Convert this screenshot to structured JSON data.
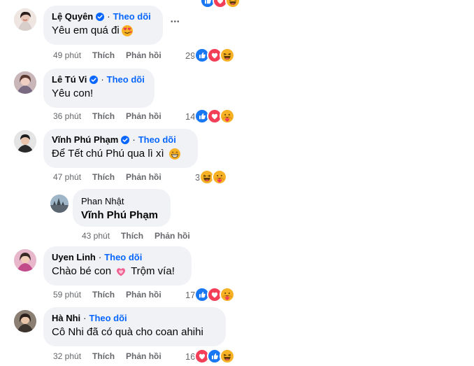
{
  "comments": [
    {
      "name": "Lệ Quyên",
      "follow": "Theo dõi",
      "text": "Yêu em quá đi",
      "emoji": "heart-eyes-emoji",
      "time": "49 phút",
      "like": "Thích",
      "reply": "Phản hồi",
      "reaction_count": "29",
      "reactions": [
        "like-reaction-icon",
        "love-reaction-icon",
        "haha-reaction-icon"
      ]
    },
    {
      "name": "Lê Tú Vi",
      "follow": "Theo dõi",
      "text": "Yêu con!",
      "time": "36 phút",
      "like": "Thích",
      "reply": "Phản hồi",
      "reaction_count": "14",
      "reactions": [
        "like-reaction-icon",
        "love-reaction-icon",
        "care-reaction-icon"
      ]
    },
    {
      "name": "Vĩnh Phú Phạm",
      "follow": "Theo dõi",
      "text": "Để Tết chú Phú qua lì xì",
      "emoji": "grin-emoji",
      "time": "47 phút",
      "like": "Thích",
      "reply": "Phản hồi",
      "reaction_count": "3",
      "reactions": [
        "haha-reaction-icon",
        "care-reaction-icon"
      ]
    },
    {
      "name": "Phan Nhật",
      "text": "Vĩnh Phú Phạm",
      "time": "43 phút",
      "like": "Thích",
      "reply": "Phản hồi"
    },
    {
      "name": "Uyen Linh",
      "follow": "Theo dõi",
      "text_before": "Chào bé con",
      "text_after": "Trộm vía!",
      "emoji": "pink-heart-emoji",
      "time": "59 phút",
      "like": "Thích",
      "reply": "Phản hồi",
      "reaction_count": "17",
      "reactions": [
        "like-reaction-icon",
        "love-reaction-icon",
        "care-reaction-icon"
      ]
    },
    {
      "name": "Hà Nhi",
      "follow": "Theo dõi",
      "text": "Cô Nhi đã có quà cho coan ahihi",
      "time": "32 phút",
      "like": "Thích",
      "reply": "Phản hồi",
      "reaction_count": "16",
      "reactions": [
        "love-reaction-icon",
        "like-reaction-icon",
        "haha-reaction-icon"
      ]
    }
  ],
  "more_options": "•••",
  "separator": "·",
  "colors": {
    "bubble": "#f0f2f5",
    "follow": "#0866ff",
    "meta": "#65676b",
    "like": "#1877f2",
    "love": "#f33e58",
    "haha": "#f7b125"
  }
}
